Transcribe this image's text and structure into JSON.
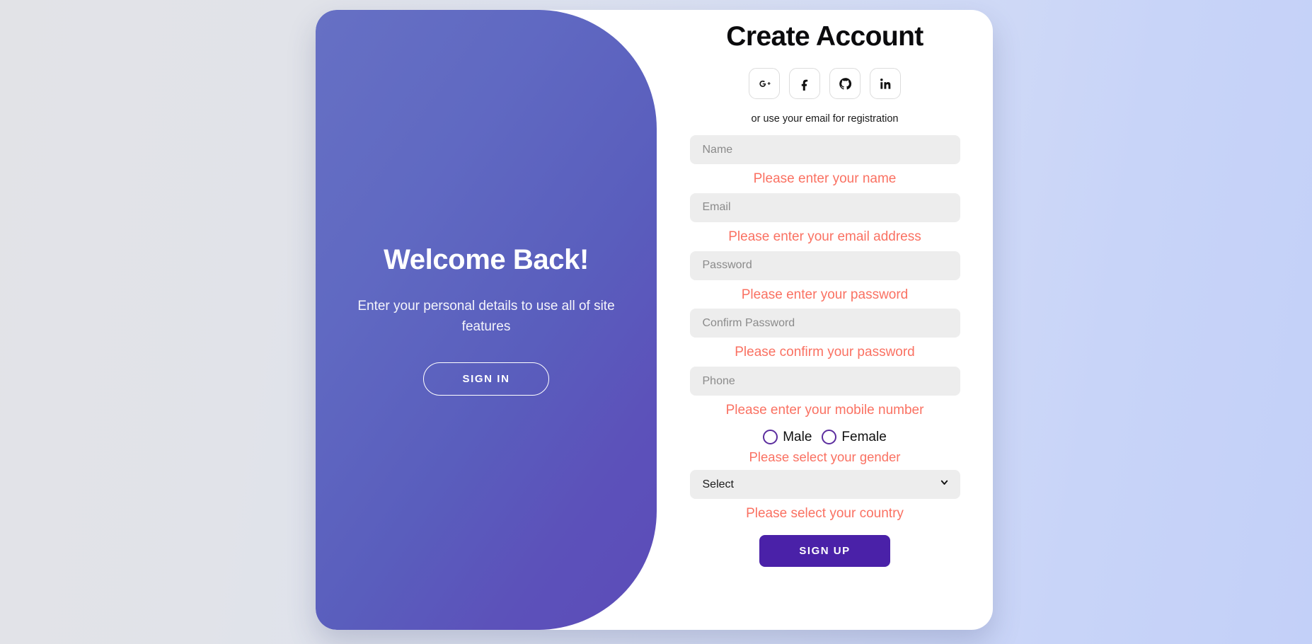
{
  "theme": {
    "brand_purple": "#4a21a8",
    "panel_purple": "#5c51ba",
    "error_color": "#fa7162",
    "field_bg": "#ededed",
    "radio_border": "#5b2d9e"
  },
  "left_panel": {
    "title": "Welcome Back!",
    "subtitle": "Enter your personal details to use all of site features",
    "sign_in_label": "SIGN IN"
  },
  "form": {
    "title": "Create Account",
    "social_buttons": [
      {
        "icon": "google-plus-icon",
        "name": "Google Plus"
      },
      {
        "icon": "facebook-icon",
        "name": "Facebook"
      },
      {
        "icon": "github-icon",
        "name": "GitHub"
      },
      {
        "icon": "linkedin-icon",
        "name": "LinkedIn"
      }
    ],
    "divider_text": "or use your email for registration",
    "fields": {
      "name": {
        "placeholder": "Name",
        "value": "",
        "error": "Please enter your name"
      },
      "email": {
        "placeholder": "Email",
        "value": "",
        "error": "Please enter your email address"
      },
      "password": {
        "placeholder": "Password",
        "value": "",
        "error": "Please enter your password"
      },
      "confirm_password": {
        "placeholder": "Confirm Password",
        "value": "",
        "error": "Please confirm your password"
      },
      "phone": {
        "placeholder": "Phone",
        "value": "",
        "error": "Please enter your mobile number"
      }
    },
    "gender": {
      "male_label": "Male",
      "female_label": "Female",
      "selected": "",
      "error": "Please select your gender"
    },
    "country": {
      "selected": "Select",
      "options": [
        "Select"
      ],
      "error": "Please select your country"
    },
    "submit_label": "SIGN UP"
  }
}
